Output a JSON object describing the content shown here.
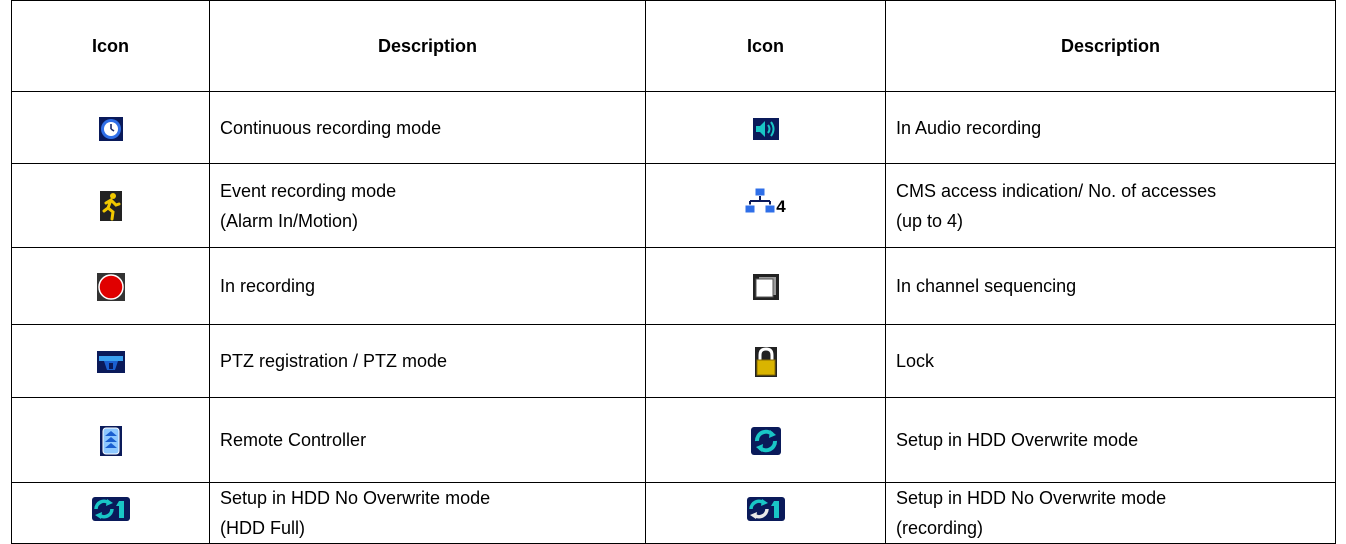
{
  "headers": {
    "icon1": "Icon",
    "desc1": "Description",
    "icon2": "Icon",
    "desc2": "Description"
  },
  "rows": [
    {
      "left_icon": "continuous-recording-clock-icon",
      "left_line1": "Continuous recording mode",
      "left_line2": "",
      "right_icon": "audio-speaker-icon",
      "right_line1": "In Audio recording",
      "right_line2": ""
    },
    {
      "left_icon": "event-recording-running-man-icon",
      "left_line1": "Event recording mode",
      "left_line2": "(Alarm In/Motion)",
      "right_icon": "cms-network-icon",
      "right_icon_num": "4",
      "right_line1": "CMS access indication/ No. of accesses",
      "right_line2": "(up to 4)"
    },
    {
      "left_icon": "recording-red-dot-icon",
      "left_line1": "In recording",
      "left_line2": "",
      "right_icon": "channel-sequencing-icon",
      "right_line1": "In channel sequencing",
      "right_line2": ""
    },
    {
      "left_icon": "ptz-camera-icon",
      "left_line1": "PTZ registration / PTZ mode",
      "left_line2": "",
      "right_icon": "lock-icon",
      "right_line1": "Lock",
      "right_line2": ""
    },
    {
      "left_icon": "remote-controller-icon",
      "left_line1": "Remote Controller",
      "left_line2": "",
      "right_icon": "hdd-overwrite-icon",
      "right_line1": "Setup in HDD Overwrite mode",
      "right_line2": ""
    },
    {
      "left_icon": "hdd-no-overwrite-full-icon",
      "left_icon_num": "1",
      "left_line1": "Setup in HDD No Overwrite mode",
      "left_line2": "(HDD Full)",
      "right_icon": "hdd-no-overwrite-recording-icon",
      "right_icon_num": "1",
      "right_line1": "Setup in HDD No Overwrite mode",
      "right_line2": "(recording)"
    }
  ],
  "colors": {
    "border": "#000000",
    "record_red": "#e00000",
    "icon_blue": "#1a5fd0",
    "icon_cyan": "#19c6c6",
    "event_yellow": "#f0c800"
  }
}
